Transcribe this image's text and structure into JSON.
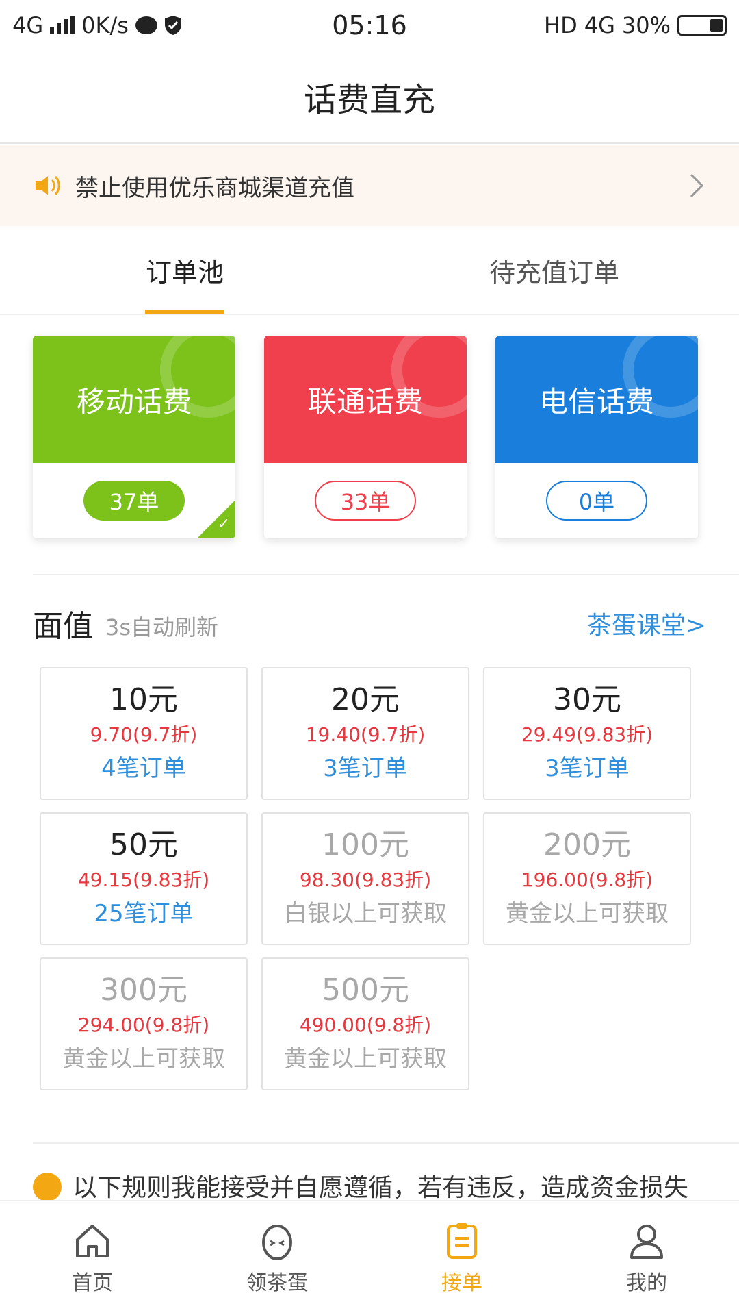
{
  "status_bar": {
    "network": "4G",
    "speed": "0K/s",
    "time": "05:16",
    "hd": "HD",
    "net_right": "4G",
    "battery": "30%"
  },
  "header": {
    "title": "话费直充"
  },
  "notice": {
    "text": "禁止使用优乐商城渠道充值"
  },
  "tabs": [
    {
      "label": "订单池",
      "active": true
    },
    {
      "label": "待充值订单",
      "active": false
    }
  ],
  "carriers": [
    {
      "name": "移动话费",
      "count": "37单",
      "color": "#7cc21b",
      "selected": true
    },
    {
      "name": "联通话费",
      "count": "33单",
      "color": "#f0404d",
      "selected": false
    },
    {
      "name": "电信话费",
      "count": "0单",
      "color": "#1a7fdc",
      "selected": false
    }
  ],
  "section": {
    "title": "面值",
    "subtitle": "3s自动刷新",
    "link": "茶蛋课堂>"
  },
  "denominations": [
    {
      "amount": "10元",
      "price": "9.70(9.7折)",
      "orders": "4笔订单",
      "disabled": false
    },
    {
      "amount": "20元",
      "price": "19.40(9.7折)",
      "orders": "3笔订单",
      "disabled": false
    },
    {
      "amount": "30元",
      "price": "29.49(9.83折)",
      "orders": "3笔订单",
      "disabled": false
    },
    {
      "amount": "50元",
      "price": "49.15(9.83折)",
      "orders": "25笔订单",
      "disabled": false
    },
    {
      "amount": "100元",
      "price": "98.30(9.83折)",
      "orders": "白银以上可获取",
      "disabled": true
    },
    {
      "amount": "200元",
      "price": "196.00(9.8折)",
      "orders": "黄金以上可获取",
      "disabled": true
    },
    {
      "amount": "300元",
      "price": "294.00(9.8折)",
      "orders": "黄金以上可获取",
      "disabled": true
    },
    {
      "amount": "500元",
      "price": "490.00(9.8折)",
      "orders": "黄金以上可获取",
      "disabled": true
    }
  ],
  "agreement": {
    "text": "以下规则我能接受并自愿遵循，若有违反，造成资金损失"
  },
  "bottom_nav": [
    {
      "label": "首页",
      "icon": "home-icon",
      "active": false
    },
    {
      "label": "领茶蛋",
      "icon": "egg-icon",
      "active": false
    },
    {
      "label": "接单",
      "icon": "order-icon",
      "active": true
    },
    {
      "label": "我的",
      "icon": "user-icon",
      "active": false
    }
  ],
  "colors": {
    "accent": "#f3a713",
    "link": "#2f8fdc",
    "price": "#e5383f"
  }
}
